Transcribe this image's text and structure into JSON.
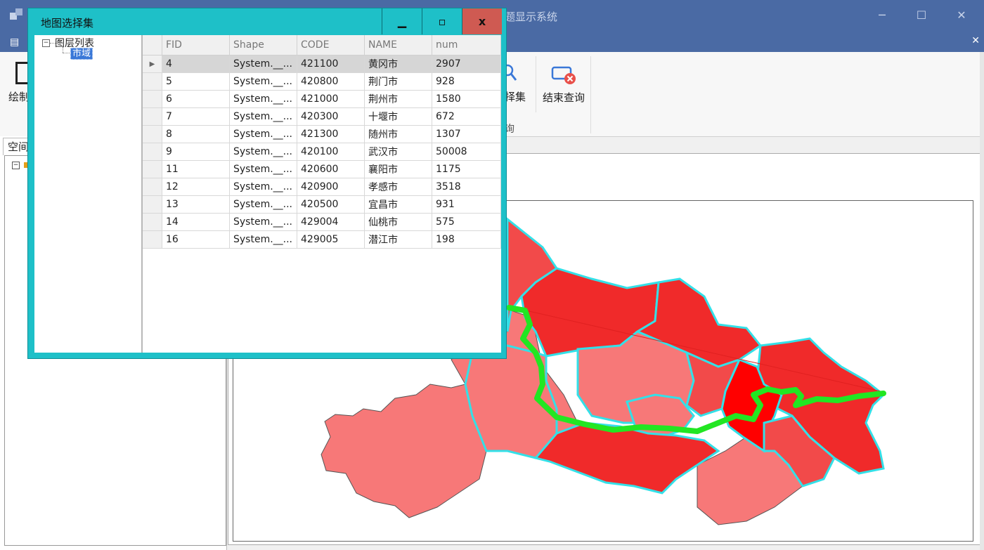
{
  "main_window": {
    "title": "题显示系统",
    "controls": {
      "minimize": "─",
      "maximize": "☐",
      "close": "✕"
    }
  },
  "ribbon": {
    "draw_label": "绘制",
    "select_label": "择集",
    "end_query_label": "结束查询",
    "group_label": "询"
  },
  "left_panel": {
    "tab_label": "空间",
    "expander": "⊟"
  },
  "dialog": {
    "title": "地图选择集",
    "controls": {
      "minimize": "▁",
      "maximize": "▫",
      "close": "x"
    },
    "tree": {
      "root_expander": "−",
      "root_label": "图层列表",
      "child_label": "市域"
    },
    "grid": {
      "columns": [
        "FID",
        "Shape",
        "CODE",
        "NAME",
        "num"
      ],
      "current_row_marker": "▶",
      "rows": [
        {
          "fid": "4",
          "shape": "System.__...",
          "code": "421100",
          "name": "黄冈市",
          "num": "2907"
        },
        {
          "fid": "5",
          "shape": "System.__...",
          "code": "420800",
          "name": "荆门市",
          "num": "928"
        },
        {
          "fid": "6",
          "shape": "System.__...",
          "code": "421000",
          "name": "荆州市",
          "num": "1580"
        },
        {
          "fid": "7",
          "shape": "System.__...",
          "code": "420300",
          "name": "十堰市",
          "num": "672"
        },
        {
          "fid": "8",
          "shape": "System.__...",
          "code": "421300",
          "name": "随州市",
          "num": "1307"
        },
        {
          "fid": "9",
          "shape": "System.__...",
          "code": "420100",
          "name": "武汉市",
          "num": "50008"
        },
        {
          "fid": "11",
          "shape": "System.__...",
          "code": "420600",
          "name": "襄阳市",
          "num": "1175"
        },
        {
          "fid": "12",
          "shape": "System.__...",
          "code": "420900",
          "name": "孝感市",
          "num": "3518"
        },
        {
          "fid": "13",
          "shape": "System.__...",
          "code": "420500",
          "name": "宜昌市",
          "num": "931"
        },
        {
          "fid": "14",
          "shape": "System.__...",
          "code": "429004",
          "name": "仙桃市",
          "num": "575"
        },
        {
          "fid": "16",
          "shape": "System.__...",
          "code": "429005",
          "name": "潜江市",
          "num": "198"
        }
      ]
    }
  },
  "map_colors": {
    "light": "#f77878",
    "medium": "#f24a4a",
    "dark": "#f02a2a",
    "darkest": "#ff0000",
    "selection_outline": "#33e0e8",
    "river": "#22e622",
    "query_line": "#e02020"
  }
}
